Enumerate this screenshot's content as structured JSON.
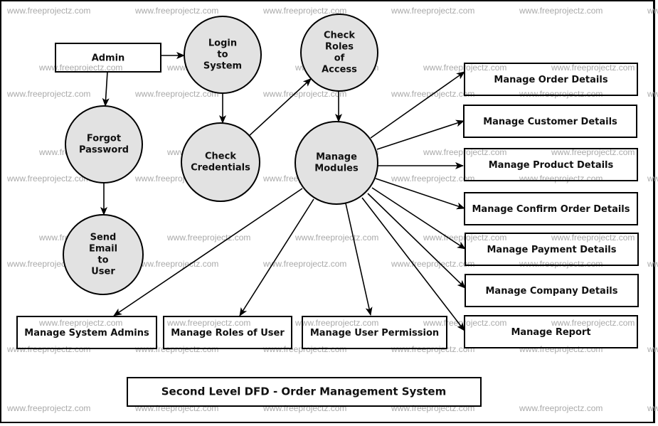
{
  "diagram": {
    "title": "Second Level DFD - Order Management System",
    "watermark": "www.freeprojectz.com",
    "colors": {
      "process_fill": "#e2e2e2",
      "stroke": "#000000",
      "text": "#111111",
      "watermark": "#aaaaaa"
    },
    "entities": [
      {
        "id": "admin",
        "label": "Admin"
      },
      {
        "id": "order",
        "label": "Manage Order Details"
      },
      {
        "id": "customer",
        "label": "Manage Customer Details"
      },
      {
        "id": "product",
        "label": "Manage Product Details"
      },
      {
        "id": "confirm",
        "label": "Manage Confirm Order Details"
      },
      {
        "id": "payment",
        "label": "Manage Payment Details"
      },
      {
        "id": "company",
        "label": "Manage Company Details"
      },
      {
        "id": "report",
        "label": "Manage Report"
      },
      {
        "id": "sysadmins",
        "label": "Manage System Admins"
      },
      {
        "id": "roles",
        "label": "Manage Roles of User"
      },
      {
        "id": "permission",
        "label": "Manage User Permission"
      }
    ],
    "processes": [
      {
        "id": "login",
        "lines": [
          "Login",
          "to",
          "System"
        ]
      },
      {
        "id": "checkroles",
        "lines": [
          "Check",
          "Roles",
          "of",
          "Access"
        ]
      },
      {
        "id": "forgot",
        "lines": [
          "Forgot",
          "Password"
        ]
      },
      {
        "id": "checkcred",
        "lines": [
          "Check",
          "Credentials"
        ]
      },
      {
        "id": "modules",
        "lines": [
          "Manage",
          "Modules"
        ]
      },
      {
        "id": "sendemail",
        "lines": [
          "Send",
          "Email",
          "to",
          "User"
        ]
      }
    ],
    "flows": [
      {
        "from": "admin",
        "to": "login"
      },
      {
        "from": "admin",
        "to": "forgot"
      },
      {
        "from": "login",
        "to": "checkcred"
      },
      {
        "from": "checkcred",
        "to": "checkroles"
      },
      {
        "from": "checkroles",
        "to": "modules"
      },
      {
        "from": "forgot",
        "to": "sendemail"
      },
      {
        "from": "modules",
        "to": "order"
      },
      {
        "from": "modules",
        "to": "customer"
      },
      {
        "from": "modules",
        "to": "product"
      },
      {
        "from": "modules",
        "to": "confirm"
      },
      {
        "from": "modules",
        "to": "payment"
      },
      {
        "from": "modules",
        "to": "company"
      },
      {
        "from": "modules",
        "to": "report"
      },
      {
        "from": "modules",
        "to": "sysadmins"
      },
      {
        "from": "modules",
        "to": "roles"
      },
      {
        "from": "modules",
        "to": "permission"
      }
    ]
  }
}
